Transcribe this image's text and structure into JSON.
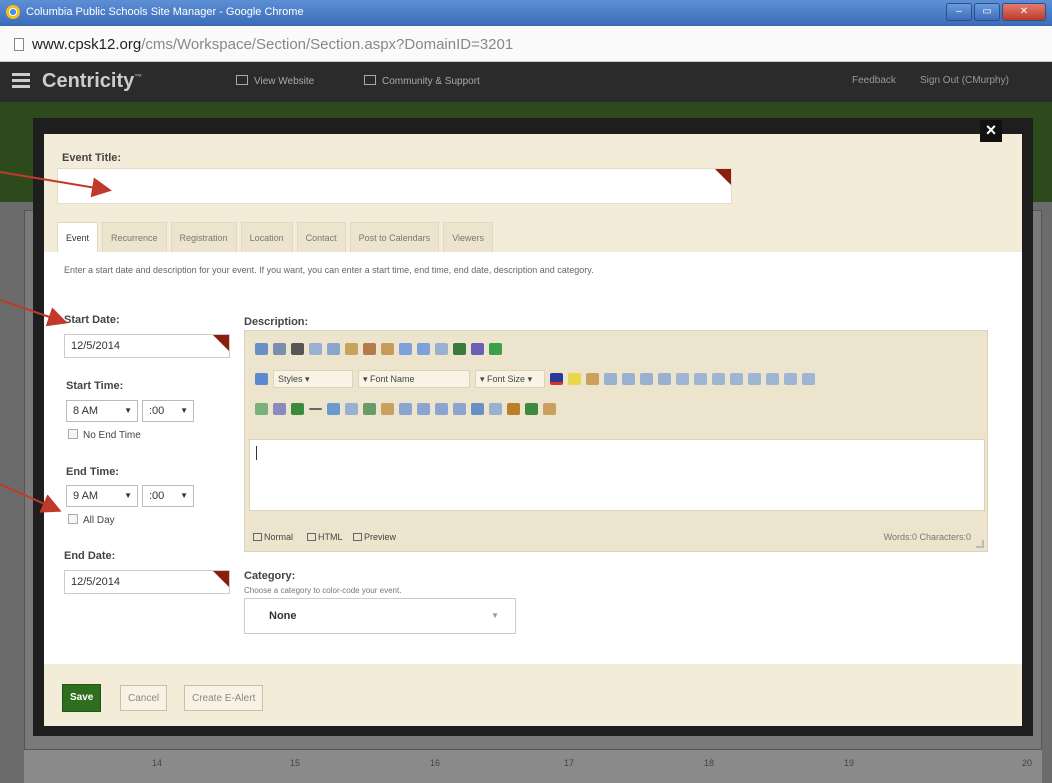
{
  "window": {
    "title": "Columbia Public Schools Site Manager - Google Chrome"
  },
  "url": {
    "host": "www.cpsk12.org",
    "path": "/cms/Workspace/Section/Section.aspx?DomainID=3201"
  },
  "app": {
    "brand": "Centricity",
    "nav": [
      "View Website",
      "Community & Support"
    ],
    "right": [
      "Feedback",
      "Sign Out (CMurphy)"
    ]
  },
  "modal": {
    "event_title_label": "Event Title:",
    "event_title_value": "",
    "tabs": [
      "Event",
      "Recurrence",
      "Registration",
      "Location",
      "Contact",
      "Post to Calendars",
      "Viewers"
    ],
    "hint": "Enter a start date and description for your event. If you want, you can enter a start time, end time, end date, description and category.",
    "start_date_label": "Start Date:",
    "start_date": "12/5/2014",
    "start_time_label": "Start Time:",
    "start_hour": "8 AM",
    "start_min": ":00",
    "no_end_time": "No End Time",
    "end_time_label": "End Time:",
    "end_hour": "9 AM",
    "end_min": ":00",
    "all_day": "All Day",
    "end_date_label": "End Date:",
    "end_date": "12/5/2014",
    "description_label": "Description:",
    "editor": {
      "styles": "Styles",
      "font_name": "Font Name",
      "font_size": "Font Size",
      "mode_normal": "Normal",
      "mode_html": "HTML",
      "mode_preview": "Preview",
      "wordcount": "Words:0 Characters:0"
    },
    "category_label": "Category:",
    "category_hint": "Choose a category to color-code your event.",
    "category_value": "None",
    "buttons": {
      "save": "Save",
      "cancel": "Cancel",
      "alert": "Create E-Alert"
    },
    "close": "×"
  },
  "background_calendar": [
    "14",
    "15",
    "16",
    "17",
    "18",
    "19",
    "20"
  ],
  "colors": {
    "accent_green": "#2f6e1f",
    "corner_red": "#8b1e0f",
    "arrow_red": "#c0392b",
    "panel": "#f3ecd8"
  }
}
